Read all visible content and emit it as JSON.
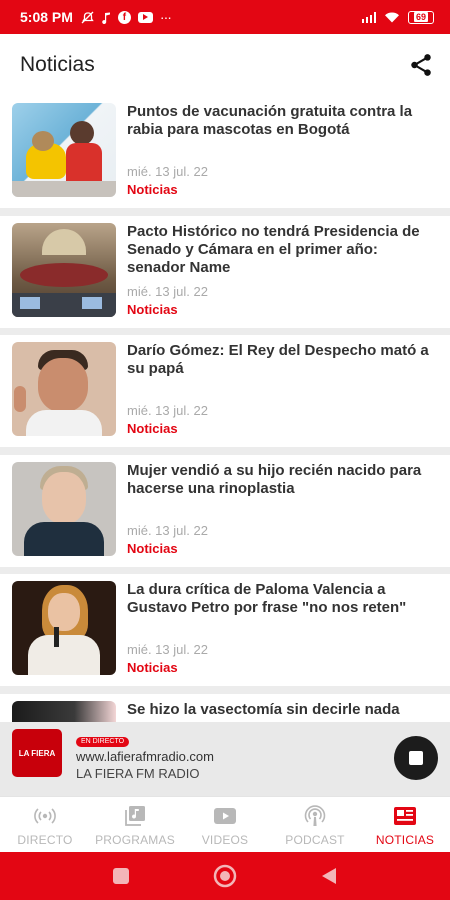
{
  "status_bar": {
    "time": "5:08 PM",
    "battery": "69",
    "icons": [
      "mute-icon",
      "music-note-icon",
      "facebook-icon",
      "youtube-icon",
      "more-icon",
      "signal-icon",
      "wifi-icon",
      "battery-icon"
    ]
  },
  "header": {
    "title": "Noticias",
    "share_icon": "share-icon"
  },
  "news": [
    {
      "title": "Puntos de vacunación gratuita contra la rabia para mascotas en Bogotá",
      "date": "mié. 13 jul. 22",
      "category": "Noticias"
    },
    {
      "title": "Pacto Histórico no tendrá Presidencia de Senado y Cámara en el primer año: senador Name",
      "date": "mié. 13 jul. 22",
      "category": "Noticias"
    },
    {
      "title": "Darío Gómez: El Rey del Despecho mató a su papá",
      "date": "mié. 13 jul. 22",
      "category": "Noticias"
    },
    {
      "title": "Mujer vendió a su hijo recién nacido para hacerse una rinoplastia",
      "date": "mié. 13 jul. 22",
      "category": "Noticias"
    },
    {
      "title": "La dura crítica de Paloma Valencia a Gustavo Petro por frase \"no nos reten\"",
      "date": "mié. 13 jul. 22",
      "category": "Noticias"
    },
    {
      "title": "Se hizo la vasectomía sin decirle nada",
      "date": "",
      "category": ""
    }
  ],
  "player": {
    "logo_text": "LA FIERA",
    "live_label": "EN DIRECTO",
    "url": "www.lafierafmradio.com",
    "station": "LA FIERA FM RADIO"
  },
  "bottom_nav": [
    {
      "label": "DIRECTO",
      "icon": "radio-waves-icon",
      "active": false
    },
    {
      "label": "PROGRAMAS",
      "icon": "music-library-icon",
      "active": false
    },
    {
      "label": "VIDEOS",
      "icon": "video-play-icon",
      "active": false
    },
    {
      "label": "PODCAST",
      "icon": "podcast-icon",
      "active": false
    },
    {
      "label": "NOTICIAS",
      "icon": "newspaper-icon",
      "active": true
    }
  ],
  "colors": {
    "accent": "#e30613",
    "inactive": "#b8b8b8"
  }
}
